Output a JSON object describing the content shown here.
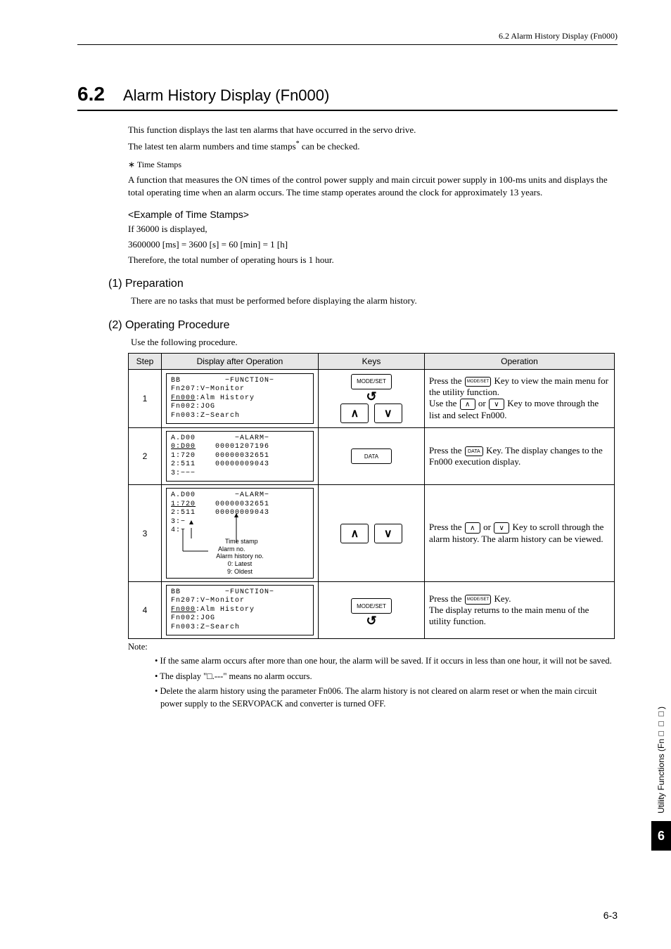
{
  "header": {
    "text": "6.2  Alarm History Display (Fn000)"
  },
  "section": {
    "num": "6.2",
    "name": "Alarm History Display (Fn000)"
  },
  "intro": {
    "l1": "This function displays the last ten alarms that have occurred in the servo drive.",
    "l2a": "The latest ten alarm numbers and time stamps",
    "l2sup": "*",
    "l2b": " can be checked."
  },
  "timestamps": {
    "ast": "∗    Time Stamps",
    "desc": "A function that measures the ON times of the control power supply and main circuit power supply in 100-ms units and displays the total operating time when an alarm occurs. The time stamp operates around the clock for approximately 13 years.",
    "ex_h": "<Example of Time Stamps>",
    "ex1": "If 36000 is displayed,",
    "ex2": "3600000 [ms] = 3600 [s] =  60 [min] = 1 [h]",
    "ex3": "Therefore, the total number of operating hours is 1 hour."
  },
  "prep": {
    "h": "(1)   Preparation",
    "p": "There are no tasks that must be performed before displaying the alarm history."
  },
  "proc": {
    "h": "(2)   Operating Procedure",
    "p": "Use the following procedure."
  },
  "table": {
    "headers": {
      "c1": "Step",
      "c2": "Display after Operation",
      "c3": "Keys",
      "c4": "Operation"
    },
    "rows": [
      {
        "step": "1",
        "disp": "BB         −FUNCTION−\nFn207:V−Monitor\nFn000:Alm History\nFn002:JOG\nFn003:Z−Search",
        "underline": "Fn000",
        "keys": {
          "type": "mode_arrows"
        },
        "op_a": "Press the ",
        "op_b": " Key to view the main menu for the utility function.",
        "op_c": "Use the ",
        "op_d": " or ",
        "op_e": " Key to move through the list and select Fn000.",
        "mode_label": "MODE/SET"
      },
      {
        "step": "2",
        "disp": "A.D00        −ALARM−\n0:D00    00001207196\n1:720    00000032651\n2:511    00000009043\n3:−−−",
        "underline": "0:D00",
        "keys": {
          "type": "data"
        },
        "op_a": "Press the ",
        "op_b": " Key. The display changes to the Fn000 execution display.",
        "data_label": "DATA"
      },
      {
        "step": "3",
        "disp": "A.D00        −ALARM−\n1:720    00000032651\n2:511    00000009043\n3:−\n4:−",
        "underline": "1:720",
        "keys": {
          "type": "arrows"
        },
        "op_a": "Press the ",
        "op_b": " or ",
        "op_c": " Key to scroll through the alarm history. The alarm history can be viewed.",
        "labels": {
          "ts": "Time stamp",
          "an": "Alarm no.",
          "ahn": "Alarm history no.",
          "lat": "0: Latest",
          "old": "9: Oldest"
        }
      },
      {
        "step": "4",
        "disp": "BB         −FUNCTION−\nFn207:V−Monitor\nFn000:Alm History\nFn002:JOG\nFn003:Z−Search",
        "underline": "Fn000",
        "keys": {
          "type": "mode"
        },
        "op_a": "Press the ",
        "op_b": " Key.",
        "op_c": "The display returns to the main menu of the utility function.",
        "mode_label": "MODE/SET"
      }
    ]
  },
  "notes": {
    "label": "Note:",
    "n1": "• If the same alarm occurs after more than one hour, the alarm will be saved. If it occurs in less than one hour, it will not be saved.",
    "n2": "• The display \"□.---\" means no alarm occurs.",
    "n3": "• Delete the alarm history using the parameter Fn006. The alarm history is not cleared on alarm reset or when the main circuit power supply to the SERVOPACK and converter is turned OFF."
  },
  "sidebar": {
    "label": "Utility Functions (Fn□□□)",
    "chapter": "6"
  },
  "footer": {
    "page": "6-3"
  },
  "glyphs": {
    "up": "∧",
    "down": "∨",
    "data": "DATA",
    "mode": "MODE/SET"
  }
}
